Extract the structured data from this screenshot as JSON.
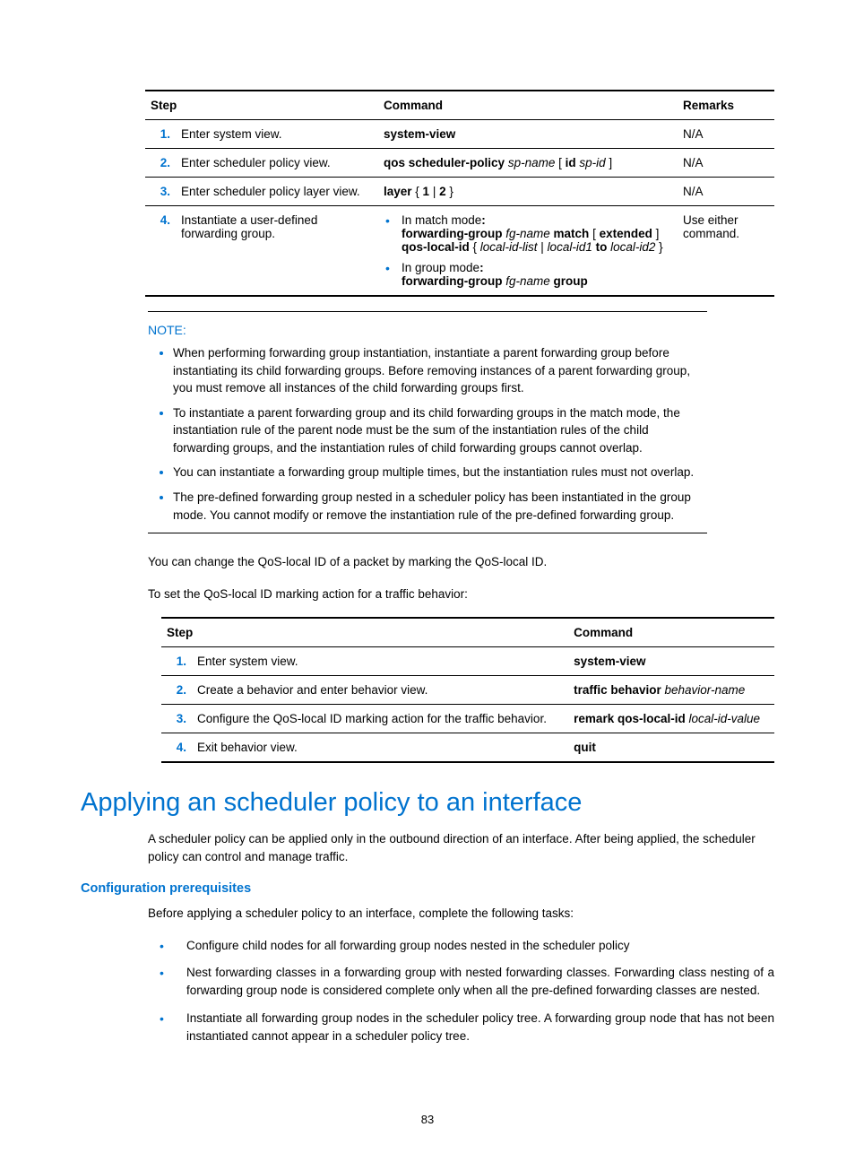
{
  "table1": {
    "headers": {
      "step": "Step",
      "command": "Command",
      "remarks": "Remarks"
    },
    "rows": [
      {
        "num": "1.",
        "step": "Enter system view.",
        "cmd_html": "<span class='bold'>system-view</span>",
        "remarks": "N/A"
      },
      {
        "num": "2.",
        "step": "Enter scheduler policy view.",
        "cmd_html": "<span class='bold'>qos scheduler-policy</span> <span class='italic'>sp-name</span> [ <span class='bold'>id</span> <span class='italic'>sp-id</span> ]",
        "remarks": "N/A"
      },
      {
        "num": "3.",
        "step": "Enter scheduler policy layer view.",
        "cmd_html": "<span class='bold'>layer</span> { <span class='bold'>1</span> | <span class='bold'>2</span> }",
        "remarks": "N/A"
      },
      {
        "num": "4.",
        "step": "Instantiate a user-defined forwarding group.",
        "cmd_html": "<ul class='cmd-bullets'><li>In match mode<span class='bold'>:</span><br><span class='bold'>forwarding-group</span> <span class='italic'>fg-name</span> <span class='bold'>match</span> [ <span class='bold'>extended</span> ] <span class='bold'>qos-local-id</span> { <span class='italic'>local-id-list</span> | <span class='italic'>local-id1</span> <span class='bold'>to</span> <span class='italic'>local-id2</span> }</li><li>In group mode<span class='bold'>:</span><br><span class='bold'>forwarding-group</span> <span class='italic'>fg-name</span> <span class='bold'>group</span></li></ul>",
        "remarks": "Use either command."
      }
    ]
  },
  "note": {
    "label": "NOTE:",
    "items": [
      "When performing forwarding group instantiation, instantiate a parent forwarding group before instantiating its child forwarding groups. Before removing instances of a parent forwarding group, you must remove all instances of the child forwarding groups first.",
      "To instantiate a parent forwarding group and its child forwarding groups in the match mode, the instantiation rule of the parent node must be the sum of the instantiation rules of the child forwarding groups, and the instantiation rules of child forwarding groups cannot overlap.",
      "You can instantiate a forwarding group multiple times, but the instantiation rules must not overlap.",
      "The pre-defined forwarding group nested in a scheduler policy has been instantiated in the group mode. You cannot modify or remove the instantiation rule of the pre-defined forwarding group."
    ]
  },
  "midtext": {
    "p1": "You can change the QoS-local ID of a packet by marking the QoS-local ID.",
    "p2": "To set the QoS-local ID marking action for a traffic behavior:"
  },
  "table2": {
    "headers": {
      "step": "Step",
      "command": "Command"
    },
    "rows": [
      {
        "num": "1.",
        "step": "Enter system view.",
        "cmd_html": "<span class='bold'>system-view</span>"
      },
      {
        "num": "2.",
        "step": "Create a behavior and enter behavior view.",
        "cmd_html": "<span class='bold'>traffic behavior</span> <span class='italic'>behavior-name</span>"
      },
      {
        "num": "3.",
        "step": "Configure the QoS-local ID marking action for the traffic behavior.",
        "cmd_html": "<span class='bold'>remark qos-local-id</span> <span class='italic'>local-id-value</span>"
      },
      {
        "num": "4.",
        "step": "Exit behavior view.",
        "cmd_html": "<span class='bold'>quit</span>"
      }
    ]
  },
  "heading": "Applying an scheduler policy to an interface",
  "heading_desc": "A scheduler policy can be applied only in the outbound direction of an interface. After being applied, the scheduler policy can control and manage traffic.",
  "subheading": "Configuration prerequisites",
  "subheading_intro": "Before applying a scheduler policy to an interface, complete the following tasks:",
  "tasks": [
    "Configure child nodes for all forwarding group nodes nested in the scheduler policy",
    "Nest forwarding classes in a forwarding group with nested forwarding classes. Forwarding class nesting of a forwarding group node is considered complete only when all the pre-defined forwarding classes are nested.",
    "Instantiate all forwarding group nodes in the scheduler policy tree. A forwarding group node that has not been instantiated cannot appear in a scheduler policy tree."
  ],
  "page_number": "83"
}
